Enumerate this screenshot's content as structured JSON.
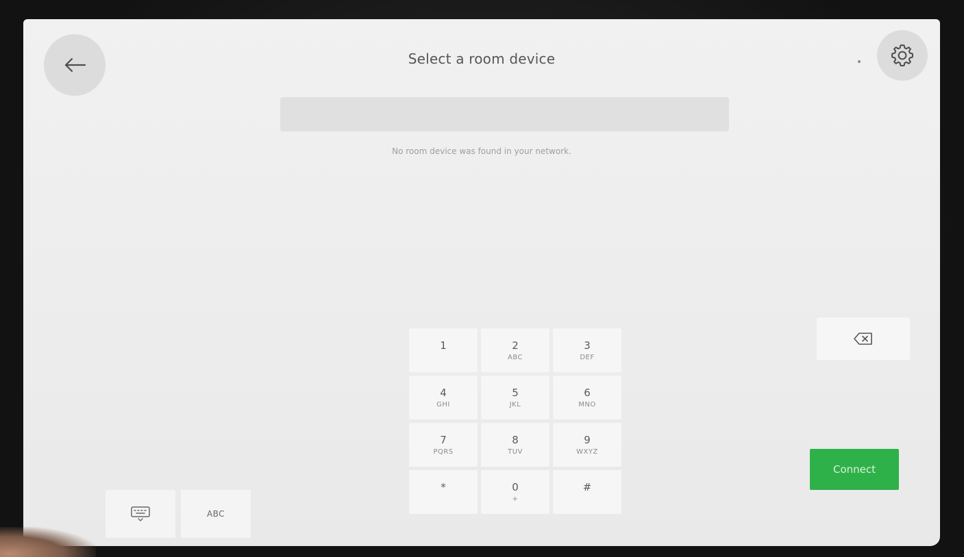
{
  "header": {
    "title": "Select a room device",
    "back_icon": "arrow-left-icon",
    "settings_icon": "gear-icon"
  },
  "search": {
    "value": "",
    "placeholder": ""
  },
  "status_message": "No room device was found in your network.",
  "keypad": {
    "keys": [
      {
        "num": "1",
        "letters": ""
      },
      {
        "num": "2",
        "letters": "ABC"
      },
      {
        "num": "3",
        "letters": "DEF"
      },
      {
        "num": "4",
        "letters": "GHI"
      },
      {
        "num": "5",
        "letters": "JKL"
      },
      {
        "num": "6",
        "letters": "MNO"
      },
      {
        "num": "7",
        "letters": "PQRS"
      },
      {
        "num": "8",
        "letters": "TUV"
      },
      {
        "num": "9",
        "letters": "WXYZ"
      },
      {
        "num": "*",
        "letters": ""
      },
      {
        "num": "0",
        "letters": "+"
      },
      {
        "num": "#",
        "letters": ""
      }
    ]
  },
  "actions": {
    "connect_label": "Connect",
    "backspace_icon": "backspace-icon",
    "keyboard_icon": "keyboard-icon",
    "abc_label": "ABC"
  },
  "colors": {
    "connect": "#2fb14a",
    "background": "#efefef"
  }
}
